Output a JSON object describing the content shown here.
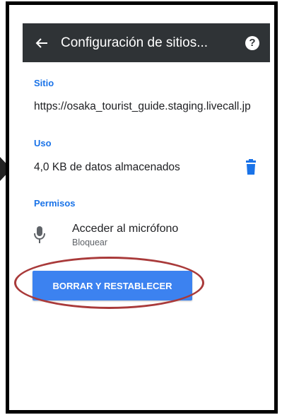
{
  "appbar": {
    "title": "Configuración de sitios...",
    "back_icon": "arrow-left-icon",
    "help_icon": "help-icon",
    "help_glyph": "?"
  },
  "site": {
    "label": "Sitio",
    "url": "https://osaka_tourist_guide.staging.livecall.jp"
  },
  "usage": {
    "label": "Uso",
    "value": "4,0 KB de datos almacenados",
    "delete_icon": "trash-icon"
  },
  "permissions": {
    "label": "Permisos",
    "items": [
      {
        "icon": "microphone-icon",
        "title": "Acceder al micrófono",
        "status": "Bloquear"
      }
    ]
  },
  "reset_button": {
    "label": "BORRAR Y RESTABLECER"
  },
  "colors": {
    "appbar": "#2f3336",
    "accent": "#1a73e8",
    "button": "#3c82f0",
    "annotation": "#a93a3a"
  }
}
